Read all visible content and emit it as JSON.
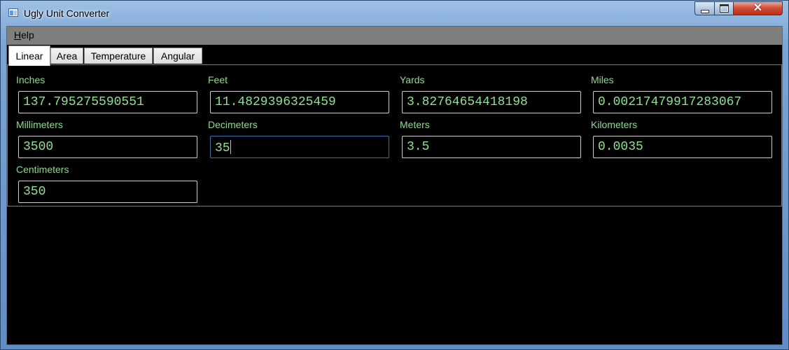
{
  "window": {
    "title": "Ugly Unit Converter"
  },
  "titlebar_buttons": {
    "minimize": "minimize-icon",
    "maximize": "maximize-icon",
    "close": "close-icon"
  },
  "menu": {
    "help": {
      "accel": "H",
      "rest": "elp"
    }
  },
  "tabs": [
    {
      "label": "Linear",
      "selected": true
    },
    {
      "label": "Area",
      "selected": false
    },
    {
      "label": "Temperature",
      "selected": false
    },
    {
      "label": "Angular",
      "selected": false
    }
  ],
  "linear": {
    "inches": {
      "label": "Inches",
      "value": "137.795275590551"
    },
    "feet": {
      "label": "Feet",
      "value": "11.4829396325459"
    },
    "yards": {
      "label": "Yards",
      "value": "3.82764654418198"
    },
    "miles": {
      "label": "Miles",
      "value": "0.00217479917283067"
    },
    "millimeters": {
      "label": "Millimeters",
      "value": "3500"
    },
    "decimeters": {
      "label": "Decimeters",
      "value": "35"
    },
    "meters": {
      "label": "Meters",
      "value": "3.5"
    },
    "kilometers": {
      "label": "Kilometers",
      "value": "0.0035"
    },
    "centimeters": {
      "label": "Centimeters",
      "value": "350"
    }
  },
  "colors": {
    "label": "#8fd98f",
    "value": "#90e090",
    "background": "#000000",
    "menubar": "#7f7f7f"
  }
}
